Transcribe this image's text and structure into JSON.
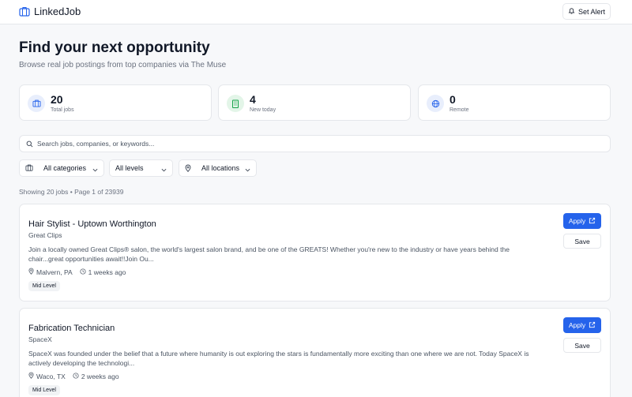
{
  "header": {
    "app_name": "LinkedJob",
    "set_alert_label": "Set Alert"
  },
  "hero": {
    "title": "Find your next opportunity",
    "subtitle": "Browse real job postings from top companies via The Muse"
  },
  "stats": [
    {
      "value": "20",
      "label": "Total jobs",
      "icon": "briefcase-icon"
    },
    {
      "value": "4",
      "label": "New today",
      "icon": "building-icon"
    },
    {
      "value": "0",
      "label": "Remote",
      "icon": "globe-icon"
    }
  ],
  "search": {
    "placeholder": "Search jobs, companies, or keywords...",
    "value": ""
  },
  "filters": {
    "category": "All categories",
    "level": "All levels",
    "location": "All locations"
  },
  "results": {
    "summary": "Showing 20 jobs • Page 1 of 23939"
  },
  "jobs": [
    {
      "title": "Hair Stylist - Uptown Worthington",
      "company": "Great Clips",
      "description": "Join a locally owned Great Clips® salon, the world's largest salon brand, and be one of the GREATS! Whether you're new to the industry or have years behind the chair...great opportunities await!!Join Ou...",
      "location": "Malvern, PA",
      "posted": "1 weeks ago",
      "level": "Mid Level",
      "apply_label": "Apply",
      "save_label": "Save"
    },
    {
      "title": "Fabrication Technician",
      "company": "SpaceX",
      "description": "SpaceX was founded under the belief that a future where humanity is out exploring the stars is fundamentally more exciting than one where we are not. Today SpaceX is actively developing the technologi...",
      "location": "Waco, TX",
      "posted": "2 weeks ago",
      "level": "Mid Level",
      "apply_label": "Apply",
      "save_label": "Save"
    }
  ],
  "colors": {
    "accent": "#2563eb",
    "page_bg": "#f7f8fa",
    "card_bg": "#ffffff",
    "border": "#e5e7eb",
    "muted_text": "#6b7280",
    "stat_blue_bg": "#e8eefc",
    "stat_green_bg": "#e3f5e8"
  }
}
